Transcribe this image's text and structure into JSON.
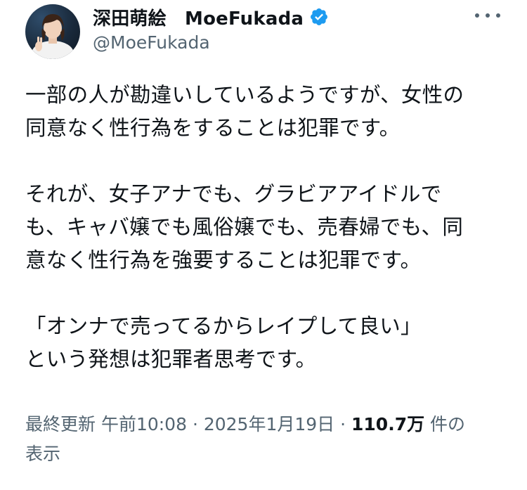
{
  "author": {
    "display_name": "深田萌絵",
    "display_name_en": "MoeFukada",
    "handle": "@MoeFukada",
    "verified": true,
    "verified_color": "#1d9bf0"
  },
  "tweet": {
    "paragraphs": [
      [
        "一部の人が勘違いしているようですが、女性の",
        "同意なく性行為をすることは犯罪です。"
      ],
      [
        "それが、女子アナでも、グラビアアイドルで",
        "も、キャバ嬢でも風俗嬢でも、売春婦でも、同",
        "意なく性行為を強要することは犯罪です。"
      ],
      [
        "「オンナで売ってるからレイプして良い」",
        "という発想は犯罪者思考です。"
      ]
    ]
  },
  "meta": {
    "prefix": "最終更新 午前10:08 · 2025年1月19日 · ",
    "views_count": "110.7万",
    "views_suffix_a": " 件の",
    "views_suffix_b": "表示"
  },
  "colors": {
    "text": "#0f1419",
    "secondary": "#536471",
    "accent": "#1d9bf0"
  },
  "icons": {
    "verified": "verified-badge-icon",
    "more": "more-options-icon"
  }
}
